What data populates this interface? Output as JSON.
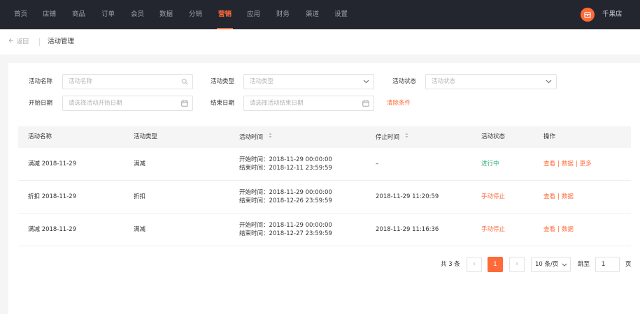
{
  "nav": {
    "items": [
      {
        "label": "首页"
      },
      {
        "label": "店铺"
      },
      {
        "label": "商品"
      },
      {
        "label": "订单"
      },
      {
        "label": "会员"
      },
      {
        "label": "数据"
      },
      {
        "label": "分销"
      },
      {
        "label": "营销"
      },
      {
        "label": "应用"
      },
      {
        "label": "财务"
      },
      {
        "label": "渠道"
      },
      {
        "label": "设置"
      }
    ],
    "active_index": 7,
    "active_color": "#ff6a39",
    "store_name": "千果店"
  },
  "subheader": {
    "back_label": "返回",
    "title": "活动管理"
  },
  "filters": {
    "name_label": "活动名称",
    "name_placeholder": "活动名称",
    "type_label": "活动类型",
    "type_placeholder": "活动类型",
    "status_label": "活动状态",
    "status_placeholder": "活动状态",
    "start_label": "开始日期",
    "start_placeholder": "请选择活动开始日期",
    "end_label": "结束日期",
    "end_placeholder": "请选择活动结束日期",
    "clear_label": "清除条件"
  },
  "table": {
    "headers": {
      "name": "活动名称",
      "type": "活动类型",
      "time": "活动时间",
      "stop": "停止时间",
      "status": "活动状态",
      "ops": "操作"
    },
    "rows": [
      {
        "name": "满减 2018-11-29",
        "type": "满减",
        "start": "开始时间：2018-11-29 00:00:00",
        "end": "结束时间：2018-12-11 23:59:59",
        "stop": "–",
        "status": "进行中",
        "ops": [
          "查看",
          "数据",
          "更多"
        ]
      },
      {
        "name": "折扣 2018-11-29",
        "type": "折扣",
        "start": "开始时间：2018-11-29 00:00:00",
        "end": "结束时间：2018-12-26 23:59:59",
        "stop": "2018-11-29 11:20:59",
        "status": "手动停止",
        "ops": [
          "查看",
          "数据"
        ]
      },
      {
        "name": "满减 2018-11-29",
        "type": "满减",
        "start": "开始时间：2018-11-29 00:00:00",
        "end": "结束时间：2018-12-27 23:59:59",
        "stop": "2018-11-29 11:16:36",
        "status": "手动停止",
        "ops": [
          "查看",
          "数据"
        ]
      }
    ],
    "op_separator": "|"
  },
  "pagination": {
    "total": "共 3 条",
    "prev_icon": "‹",
    "current": "1",
    "next_icon": "›",
    "page_size": "10 条/页",
    "jump_label": "跳至",
    "jump_value": "1",
    "jump_suffix": "页"
  }
}
